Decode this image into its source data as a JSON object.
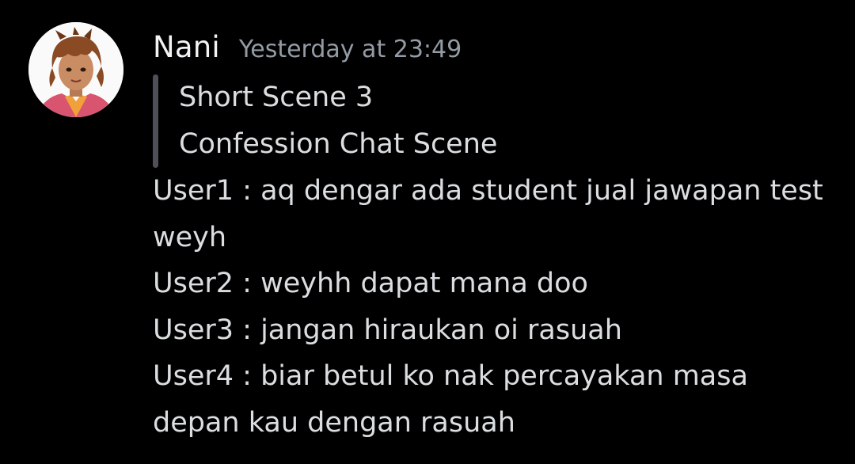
{
  "message": {
    "author": "Nani",
    "timestamp": "Yesterday at 23:49",
    "avatar_icon": "avatar-illustration-icon",
    "quote_lines": [
      "Short Scene 3",
      "Confession Chat Scene"
    ],
    "body_lines": [
      "User1 : aq dengar ada student jual jawapan test",
      "weyh",
      "User2 : weyhh dapat mana doo",
      "User3 : jangan hiraukan oi rasuah",
      "User4 : biar betul ko nak percayakan masa",
      "depan kau dengan rasuah"
    ]
  },
  "colors": {
    "background": "#000000",
    "username": "#f2f3f5",
    "timestamp": "#949ba4",
    "text": "#dbdee1",
    "quote_bar": "#4e5058"
  }
}
